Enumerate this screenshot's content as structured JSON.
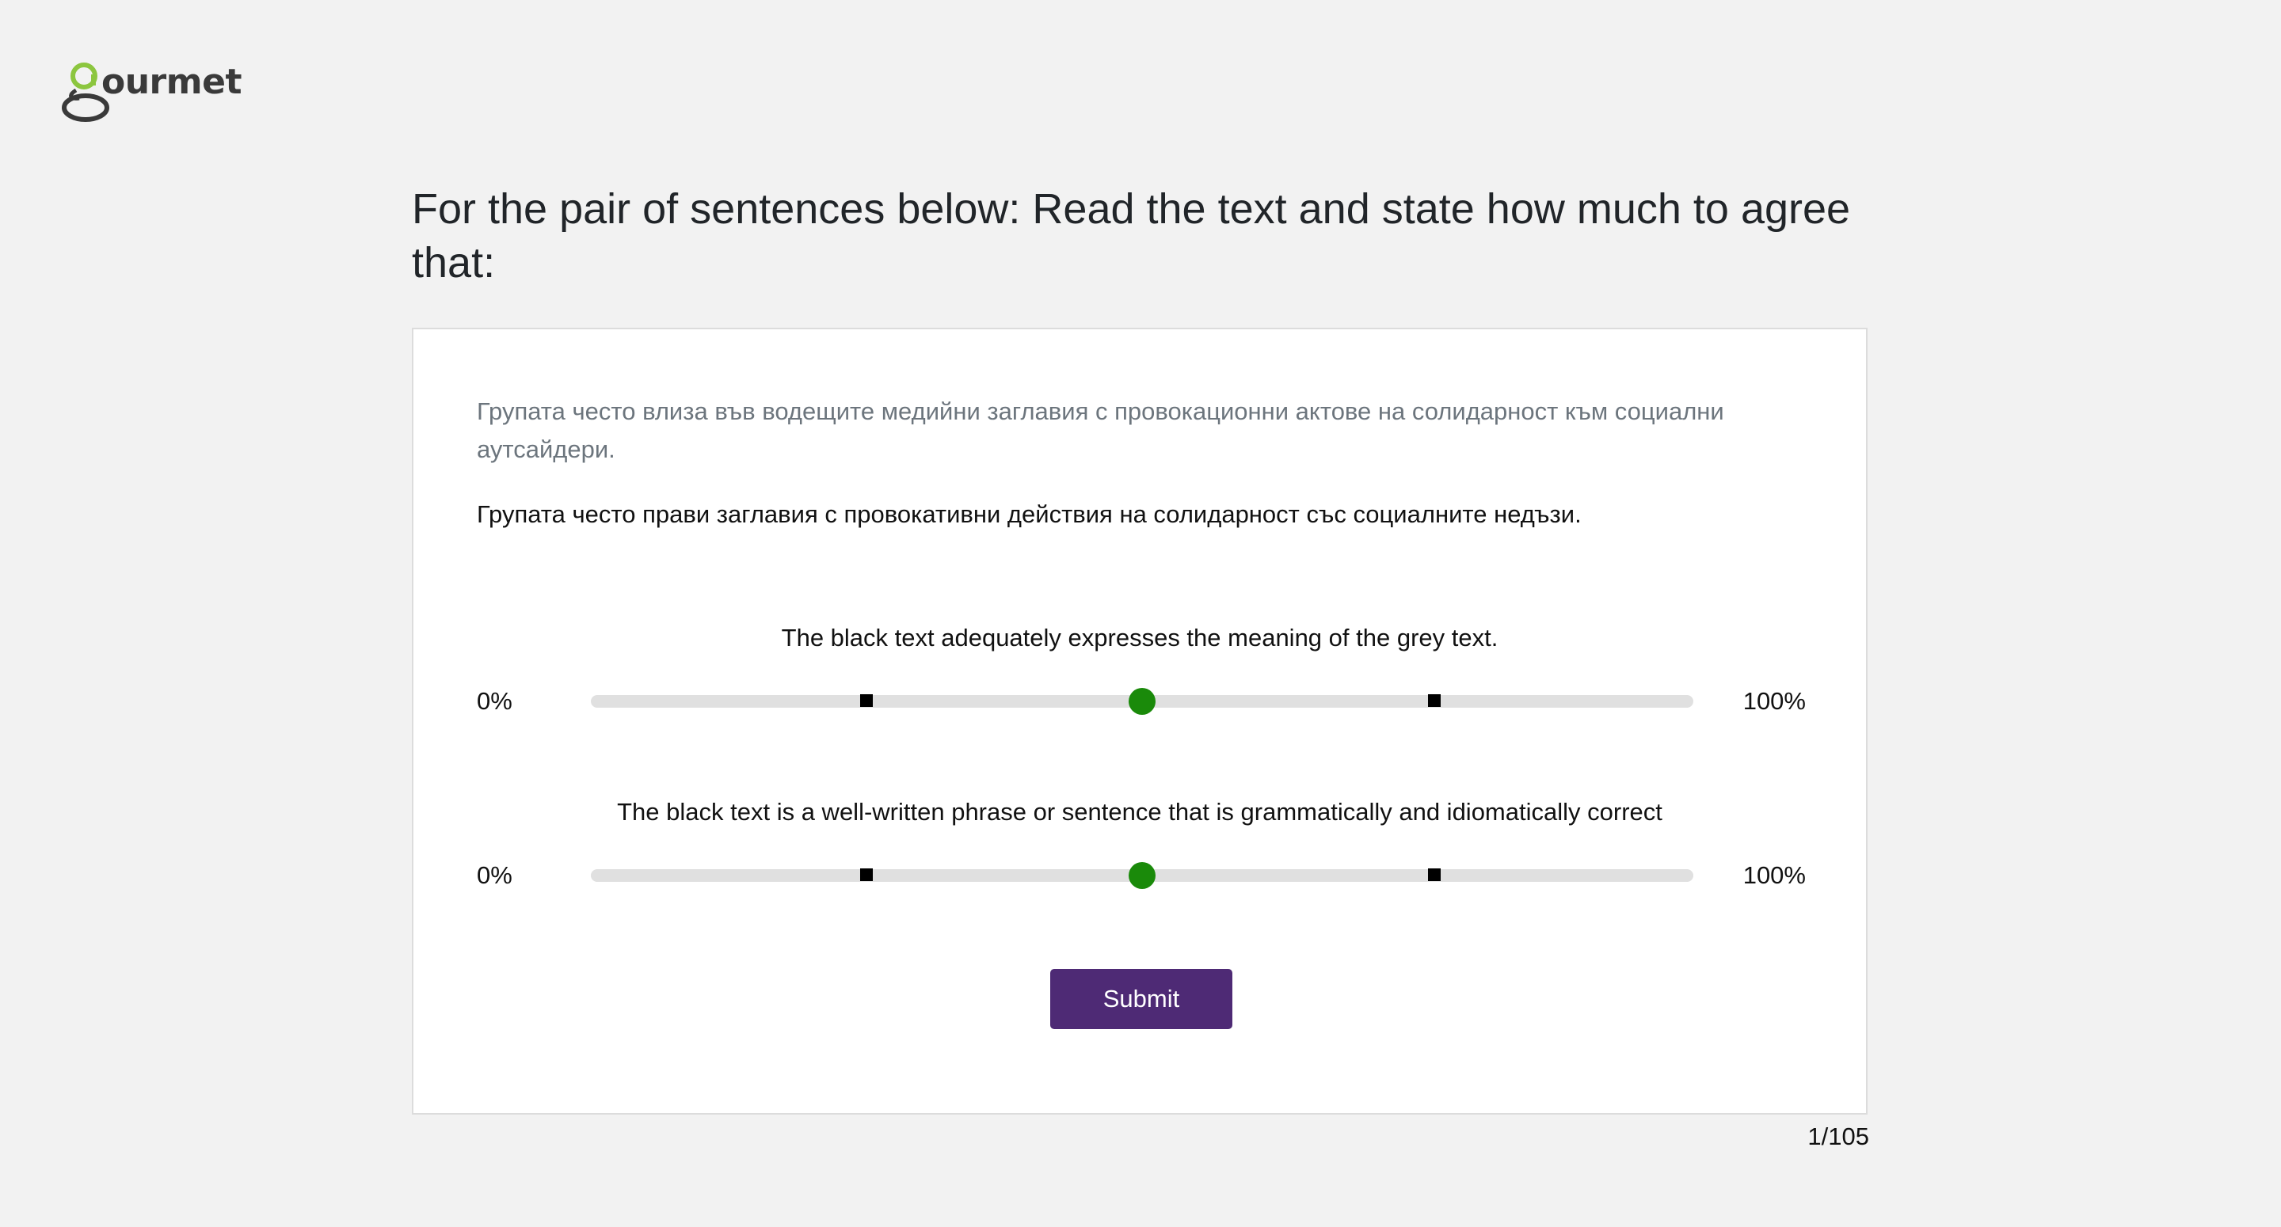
{
  "logo": {
    "text": "ourmet"
  },
  "heading": "For the pair of sentences below: Read the text and state how much to agree that:",
  "source_text": "Групата често влиза във водещите медийни заглавия с провокационни актове на солидарност към социални аутсайдери.",
  "target_text": "Групата често прави заглавия с провокативни действия на солидарност със социалните недъзи.",
  "questions": [
    {
      "label": "The black text adequately expresses the meaning of the grey text.",
      "min_label": "0%",
      "max_label": "100%",
      "value": 0.5
    },
    {
      "label": "The black text is a well-written phrase or sentence that is grammatically and idiomatically correct",
      "min_label": "0%",
      "max_label": "100%",
      "value": 0.5
    }
  ],
  "submit_label": "Submit",
  "progress": "1/105",
  "colors": {
    "accent": "#4e2a75",
    "thumb": "#1a8a0a",
    "logo_green": "#8cc63f"
  }
}
